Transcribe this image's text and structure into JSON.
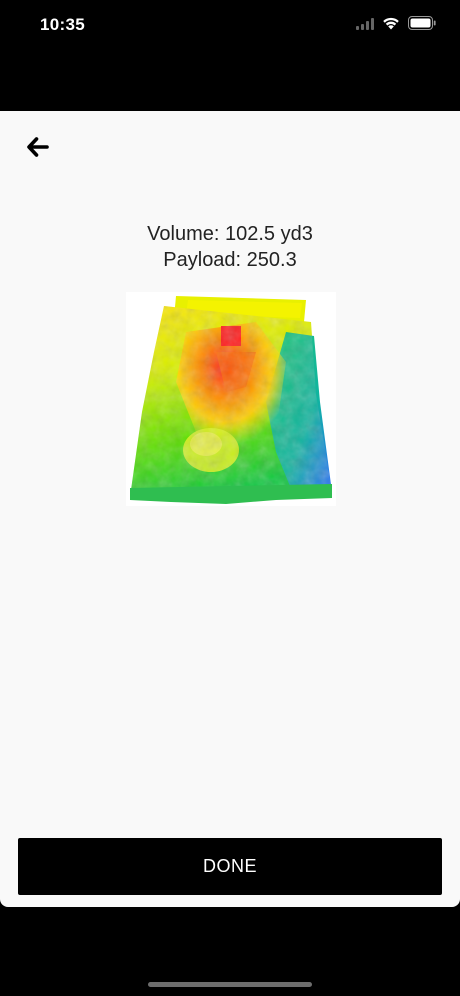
{
  "status_bar": {
    "time": "10:35"
  },
  "header": {
    "back_icon": "arrow-left-icon"
  },
  "measurement": {
    "volume_text": "Volume: 102.5 yd3",
    "payload_text": "Payload: 250.3"
  },
  "scan": {
    "image_kind": "3d-height-map",
    "colors": [
      "#ff2020",
      "#ff9000",
      "#ffe600",
      "#9cf000",
      "#10c850",
      "#3b6cff"
    ]
  },
  "footer": {
    "done_label": "DONE"
  }
}
